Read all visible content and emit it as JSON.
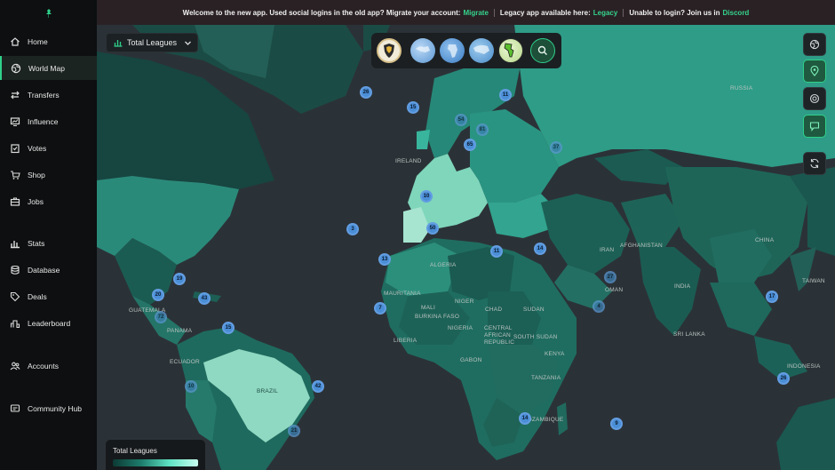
{
  "sidebar": {
    "items": [
      {
        "label": "Home",
        "icon": "home-icon"
      },
      {
        "label": "World Map",
        "icon": "globe-icon",
        "active": true
      },
      {
        "label": "Transfers",
        "icon": "transfer-icon"
      },
      {
        "label": "Influence",
        "icon": "influence-icon"
      },
      {
        "label": "Votes",
        "icon": "votes-icon"
      },
      {
        "label": "Shop",
        "icon": "cart-icon"
      },
      {
        "label": "Jobs",
        "icon": "briefcase-icon"
      },
      {
        "label": "Stats",
        "icon": "stats-icon"
      },
      {
        "label": "Database",
        "icon": "database-icon"
      },
      {
        "label": "Deals",
        "icon": "tag-icon"
      },
      {
        "label": "Leaderboard",
        "icon": "leaderboard-icon"
      },
      {
        "label": "Accounts",
        "icon": "accounts-icon"
      },
      {
        "label": "Community Hub",
        "icon": "community-icon"
      }
    ]
  },
  "banner": {
    "welcome": "Welcome to the new app. Used social logins in the old app? Migrate your account:",
    "migrate_link": "Migrate",
    "legacy_text": "Legacy app available here:",
    "legacy_link": "Legacy",
    "login_text": "Unable to login? Join us in",
    "discord_link": "Discord"
  },
  "league_selector": {
    "label": "Total Leagues"
  },
  "legend": {
    "title": "Total Leagues"
  },
  "colors": {
    "accent": "#2fd08a",
    "cluster": "#4a8ed6",
    "banner": "#2a2125"
  },
  "country_labels": [
    "RUSSIA",
    "IRELAND",
    "ALGERIA",
    "CHINA",
    "AFGHANISTAN",
    "IRAN",
    "OMAN",
    "INDIA",
    "TAIWAN",
    "SRI LANKA",
    "INDONESIA",
    "MAURITANIA",
    "MALI",
    "NIGER",
    "CHAD",
    "SUDAN",
    "SOUTH SUDAN",
    "BURKINA FASO",
    "NIGERIA",
    "CENTRAL AFRICAN REPUBLIC",
    "KENYA",
    "GABON",
    "TANZANIA",
    "LIBERIA",
    "MOZAMBIQUE",
    "ECUADOR",
    "GUATEMALA",
    "PANAMA",
    "BRAZIL"
  ],
  "clusters": [
    "26",
    "15",
    "11",
    "50",
    "65",
    "81",
    "54",
    "37",
    "10",
    "3",
    "13",
    "14",
    "11",
    "20",
    "19",
    "43",
    "7",
    "27",
    "4",
    "17",
    "26",
    "9",
    "72",
    "42",
    "15",
    "10",
    "21",
    "14"
  ]
}
